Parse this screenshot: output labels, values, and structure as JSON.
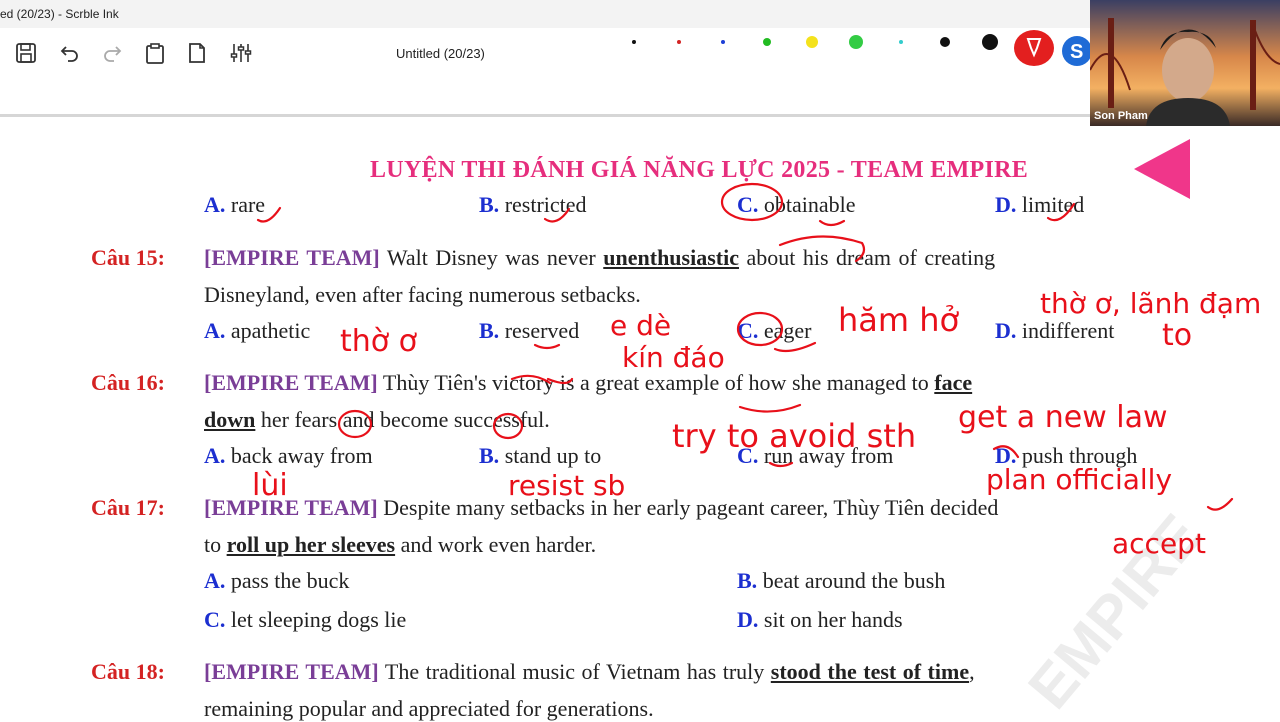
{
  "window": {
    "title": "ed (20/23) - Scrble Ink"
  },
  "toolbar": {
    "doc_title": "Untitled (20/23)",
    "colors": [
      "#111111",
      "#d32424",
      "#1d3fd6",
      "#22bb22",
      "#f4e21c",
      "#33cc44",
      "#33cccc",
      "#111111",
      "#111111",
      "#e31f1f",
      "#1f6bd6"
    ]
  },
  "camera": {
    "name": "Son Pham"
  },
  "doc": {
    "banner": "LUYỆN THI ĐÁNH GIÁ NĂNG LỰC 2025 - TEAM EMPIRE",
    "watermark": "EMPIRE",
    "q14": {
      "a_letter": "A.",
      "a": "rare",
      "b_letter": "B.",
      "b": "restricted",
      "c_letter": "C.",
      "c": "obtainable",
      "d_letter": "D.",
      "d": "limited"
    },
    "q15": {
      "num": "Câu 15:",
      "team": "[EMPIRE TEAM]",
      "pre": "Walt Disney was never",
      "key": "unenthusiastic",
      "post": "about his dream of creating",
      "line2": "Disneyland, even after facing numerous setbacks.",
      "a_letter": "A.",
      "a": "apathetic",
      "b_letter": "B.",
      "b": "reserved",
      "c_letter": "C.",
      "c": "eager",
      "d_letter": "D.",
      "d": "indifferent"
    },
    "q16": {
      "num": "Câu 16:",
      "team": "[EMPIRE TEAM]",
      "pre": "Thùy Tiên's victory is a great example of how she managed to",
      "key1": "face",
      "key2": "down",
      "line2": "her fears and become successful.",
      "a_letter": "A.",
      "a": "back away from",
      "b_letter": "B.",
      "b": "stand up to",
      "c_letter": "C.",
      "c": "run away from",
      "d_letter": "D.",
      "d": "push through"
    },
    "q17": {
      "num": "Câu 17:",
      "team": "[EMPIRE TEAM]",
      "line1": "Despite many setbacks in her early pageant career, Thùy Tiên decided",
      "pre2": "to",
      "key": "roll up her sleeves",
      "post2": "and work even harder.",
      "a_letter": "A.",
      "a": "pass the buck",
      "b_letter": "B.",
      "b": "beat around the bush",
      "c_letter": "C.",
      "c": "let sleeping dogs lie",
      "d_letter": "D.",
      "d": "sit on her hands"
    },
    "q18": {
      "num": "Câu 18:",
      "team": "[EMPIRE TEAM]",
      "pre": "The traditional music of Vietnam has truly",
      "key": "stood the test of time",
      "post": ",",
      "line2": "remaining popular and appreciated for generations."
    }
  },
  "ink_notes": {
    "n1": "thờ ơ",
    "n2": "e dè",
    "n3": "kín đáo",
    "n4": "hăm hở",
    "n5": "thờ ơ, lãnh đạm",
    "n6": "to",
    "n7": "lùi",
    "n8": "resist sb",
    "n9": "try to avoid sth",
    "n10": "get a new law",
    "n11": "plan officially",
    "n12": "accept"
  }
}
